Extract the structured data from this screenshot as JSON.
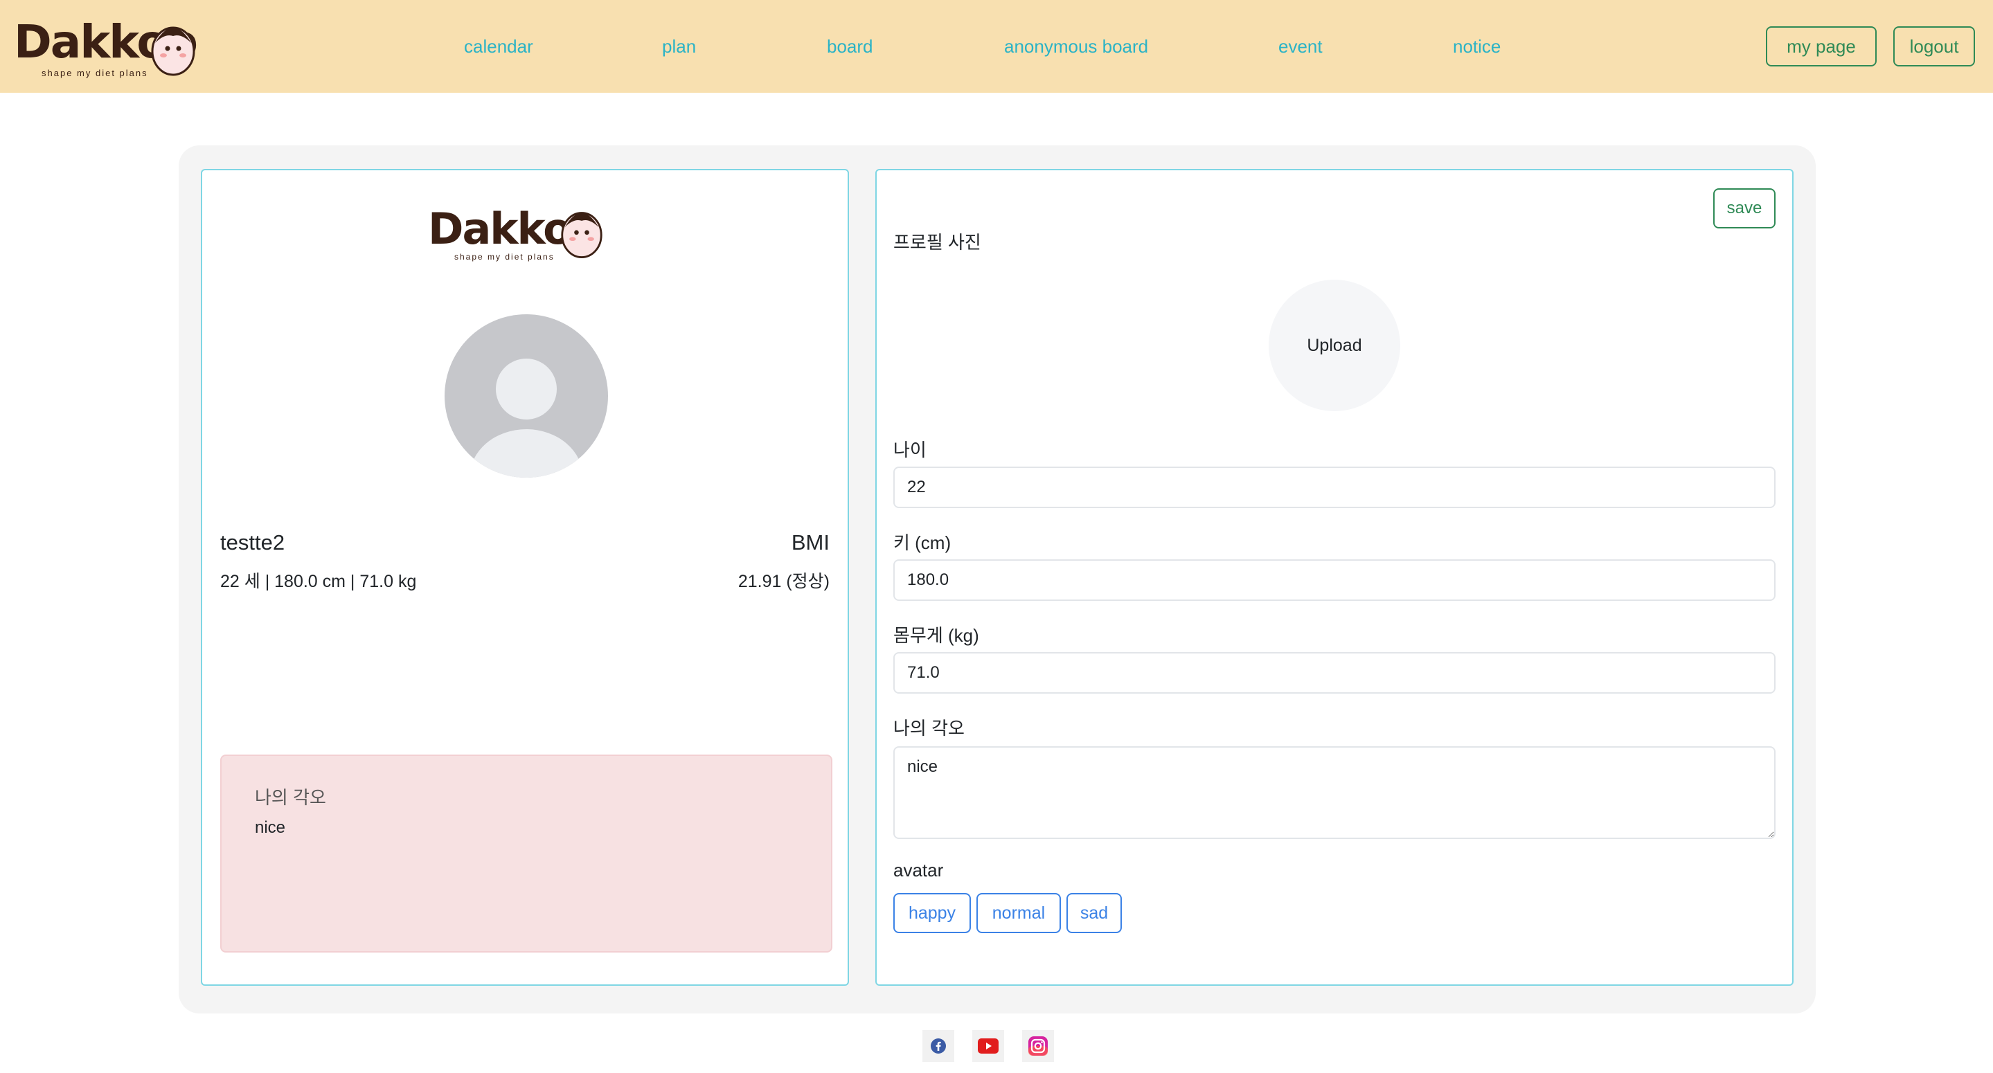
{
  "brand": {
    "name": "Dakkoo",
    "tagline": "shape my diet plans"
  },
  "nav": {
    "links": [
      "calendar",
      "plan",
      "board",
      "anonymous board",
      "event",
      "notice"
    ],
    "my_page": "my page",
    "logout": "logout"
  },
  "profile": {
    "username": "testte2",
    "bmi_label": "BMI",
    "stats": "22 세 | 180.0 cm | 71.0 kg",
    "bmi_value": "21.91 (정상)",
    "resolve_title": "나의 각오",
    "resolve_text": "nice"
  },
  "form": {
    "save": "save",
    "photo_label": "프로필 사진",
    "upload": "Upload",
    "age_label": "나이",
    "age_value": "22",
    "height_label": "키 (cm)",
    "height_value": "180.0",
    "weight_label": "몸무게 (kg)",
    "weight_value": "71.0",
    "resolve_label": "나의 각오",
    "resolve_value": "nice",
    "avatar_label": "avatar",
    "avatar_options": [
      "happy",
      "normal",
      "sad"
    ]
  },
  "footer": {
    "icons": [
      "facebook-icon",
      "youtube-icon",
      "instagram-icon"
    ]
  },
  "colors": {
    "navbar_bg": "#f8e0b0",
    "nav_link": "#2bb3c6",
    "nav_button": "#2f8a56",
    "card_border": "#7fd6e4",
    "resolve_bg": "#f7e1e2",
    "avatar_button": "#3b82e6"
  }
}
